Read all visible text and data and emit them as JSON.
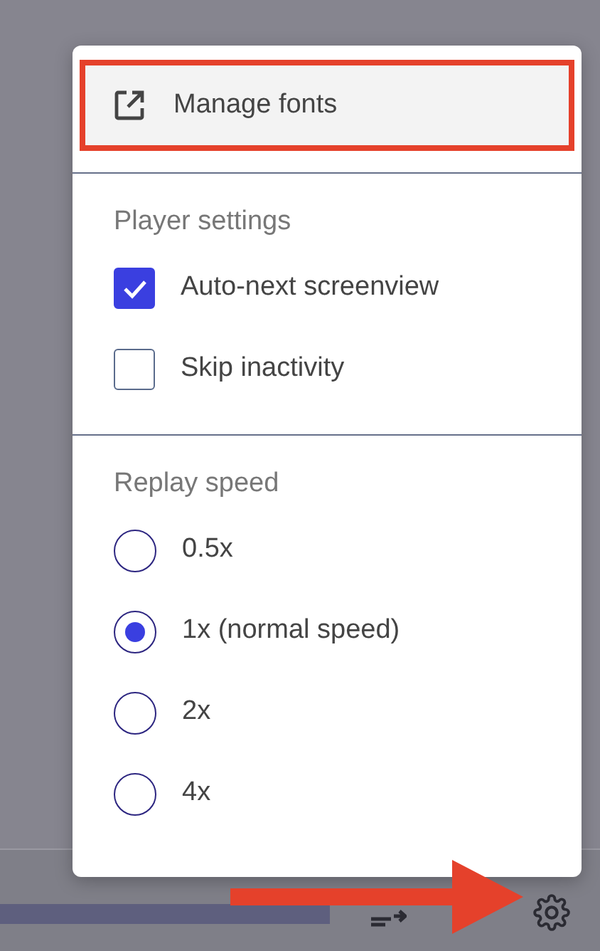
{
  "menu": {
    "link": {
      "label": "Manage fonts",
      "highlighted": true
    },
    "sections": [
      {
        "title": "Player settings",
        "kind": "checkbox",
        "options": [
          {
            "label": "Auto-next screenview",
            "checked": true
          },
          {
            "label": "Skip inactivity",
            "checked": false
          }
        ]
      },
      {
        "title": "Replay speed",
        "kind": "radio",
        "options": [
          {
            "label": "0.5x",
            "selected": false
          },
          {
            "label": "1x (normal speed)",
            "selected": true
          },
          {
            "label": "2x",
            "selected": false
          },
          {
            "label": "4x",
            "selected": false
          }
        ]
      }
    ]
  }
}
